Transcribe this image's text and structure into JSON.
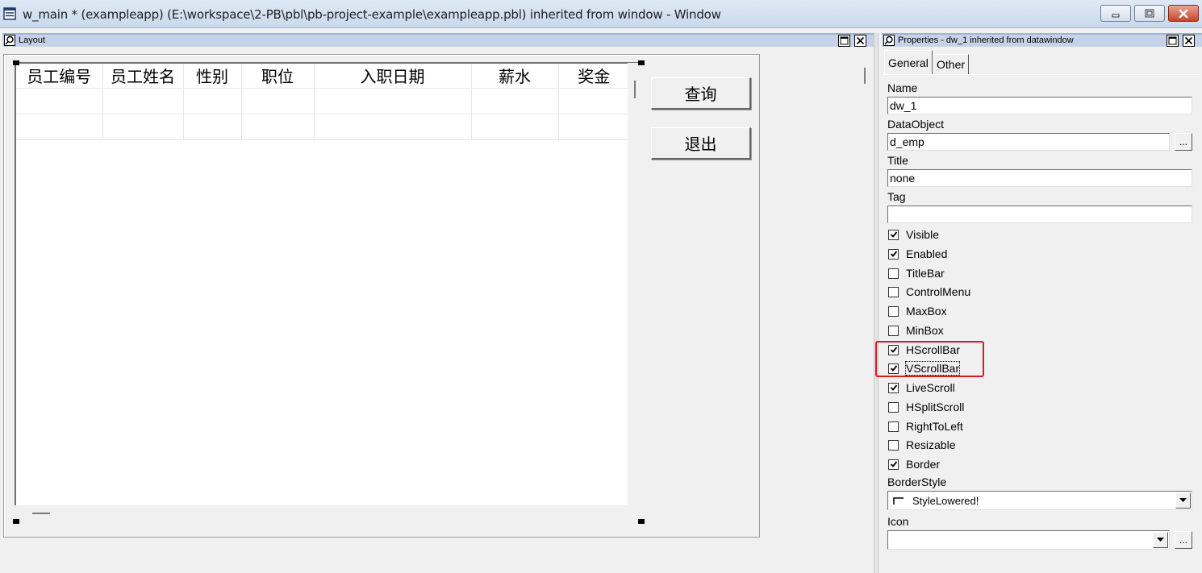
{
  "window": {
    "title": "w_main * (exampleapp) (E:\\workspace\\2-PB\\pbl\\pb-project-example\\exampleapp.pbl) inherited from window - Window"
  },
  "layout_panel": {
    "title": "Layout",
    "columns": [
      "员工编号",
      "员工姓名",
      "性别",
      "职位",
      "入职日期",
      "薪水",
      "奖金"
    ],
    "buttons": {
      "query": "查询",
      "exit": "退出"
    }
  },
  "properties_panel": {
    "title": "Properties - dw_1 inherited from datawindow",
    "tabs": [
      "General",
      "Other"
    ],
    "fields": {
      "name_label": "Name",
      "name_value": "dw_1",
      "dataobject_label": "DataObject",
      "dataobject_value": "d_emp",
      "title_label": "Title",
      "title_value": "none",
      "tag_label": "Tag",
      "tag_value": "",
      "borderstyle_label": "BorderStyle",
      "borderstyle_value": "StyleLowered!",
      "icon_label": "Icon",
      "icon_value": "",
      "ellipsis": "..."
    },
    "checkboxes": [
      {
        "label": "Visible",
        "checked": true
      },
      {
        "label": "Enabled",
        "checked": true
      },
      {
        "label": "TitleBar",
        "checked": false
      },
      {
        "label": "ControlMenu",
        "checked": false
      },
      {
        "label": "MaxBox",
        "checked": false
      },
      {
        "label": "MinBox",
        "checked": false
      },
      {
        "label": "HScrollBar",
        "checked": true
      },
      {
        "label": "VScrollBar",
        "checked": true
      },
      {
        "label": "LiveScroll",
        "checked": true
      },
      {
        "label": "HSplitScroll",
        "checked": false
      },
      {
        "label": "RightToLeft",
        "checked": false
      },
      {
        "label": "Resizable",
        "checked": false
      },
      {
        "label": "Border",
        "checked": true
      }
    ]
  },
  "colors": {
    "highlight": "#e0191e",
    "title_gradient_top": "#dfe9f5",
    "panel_title": "#c6d3e6"
  }
}
